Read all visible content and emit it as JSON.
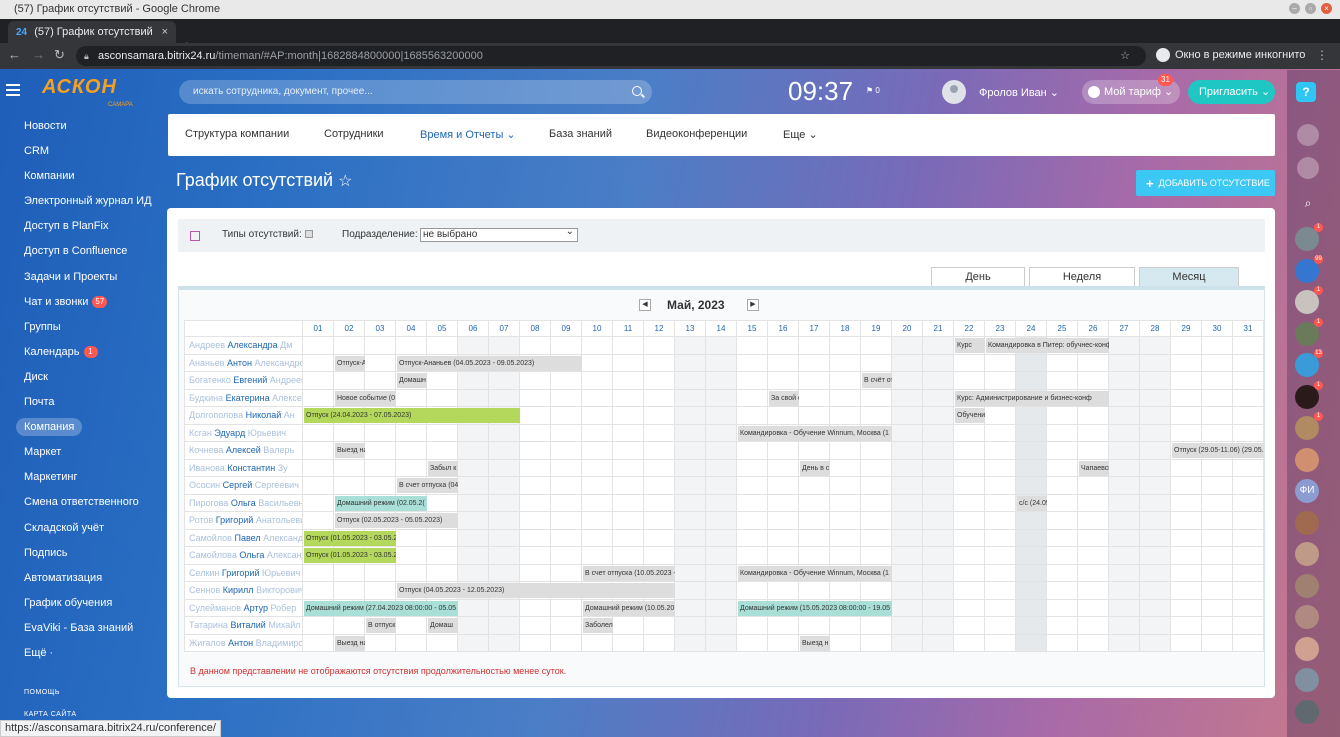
{
  "browser": {
    "window_title": "(57) График отсутствий - Google Chrome",
    "tab_title": "(57) График отсутствий",
    "tab_favicon": "24",
    "url_host": "asconsamara.bitrix24.ru",
    "url_path": "/timeman/#AP:month|1682884800000|1685563200000",
    "incognito_label": "Окно в режиме инкогнито",
    "status_url": "https://asconsamara.bitrix24.ru/conference/"
  },
  "header": {
    "logo_text": "АСКОН",
    "logo_sub": "САМАРА",
    "search_placeholder": "искать сотрудника, документ, прочее...",
    "clock": "09:37",
    "flag_count": "0",
    "user_name": "Фролов Иван",
    "tariff_label": "Мой тариф",
    "tariff_badge": "31",
    "invite_label": "Пригласить"
  },
  "sidebar": {
    "items": [
      {
        "label": "Новости",
        "badge": ""
      },
      {
        "label": "CRM",
        "badge": ""
      },
      {
        "label": "Компании",
        "badge": ""
      },
      {
        "label": "Электронный журнал ИД",
        "badge": ""
      },
      {
        "label": "Доступ в PlanFix",
        "badge": ""
      },
      {
        "label": "Доступ в Confluence",
        "badge": ""
      },
      {
        "label": "Задачи и Проекты",
        "badge": ""
      },
      {
        "label": "Чат и звонки",
        "badge": "57"
      },
      {
        "label": "Группы",
        "badge": ""
      },
      {
        "label": "Календарь",
        "badge": "1"
      },
      {
        "label": "Диск",
        "badge": ""
      },
      {
        "label": "Почта",
        "badge": ""
      },
      {
        "label": "Компания",
        "badge": "",
        "active": true
      },
      {
        "label": "Маркет",
        "badge": ""
      },
      {
        "label": "Маркетинг",
        "badge": ""
      },
      {
        "label": "Смена ответственного",
        "badge": ""
      },
      {
        "label": "Складской учёт",
        "badge": ""
      },
      {
        "label": "Подпись",
        "badge": ""
      },
      {
        "label": "Автоматизация",
        "badge": ""
      },
      {
        "label": "График обучения",
        "badge": ""
      },
      {
        "label": "EvaViki - База знаний",
        "badge": ""
      },
      {
        "label": "Ещё ·",
        "badge": ""
      }
    ],
    "help_label": "ПОМОЩЬ",
    "sitemap_label": "КАРТА САЙТА"
  },
  "topnav": {
    "items": [
      "Структура компании",
      "Сотрудники",
      "Время и Отчеты ⌄",
      "База знаний",
      "Видеоконференции",
      "Еще ⌄"
    ]
  },
  "page": {
    "title": "График отсутствий",
    "add_button": "ДОБАВИТЬ ОТСУТСТВИЕ"
  },
  "filter": {
    "types_label": "Типы отсутствий:",
    "division_label": "Подразделение:",
    "division_value": "не выбрано"
  },
  "views": {
    "day": "День",
    "week": "Неделя",
    "month": "Месяц"
  },
  "calendar": {
    "month_label": "Май, 2023",
    "days": [
      "01",
      "02",
      "03",
      "04",
      "05",
      "06",
      "07",
      "08",
      "09",
      "10",
      "11",
      "12",
      "13",
      "14",
      "15",
      "16",
      "17",
      "18",
      "19",
      "20",
      "21",
      "22",
      "23",
      "24",
      "25",
      "26",
      "27",
      "28",
      "29",
      "30",
      "31"
    ],
    "weekend_days": [
      6,
      7,
      13,
      14,
      20,
      21,
      27,
      28
    ],
    "today_day": 24,
    "employees": [
      {
        "blurred": "Андреев",
        "name": "Александра",
        "tail": "Дм"
      },
      {
        "blurred": "Ананьев",
        "name": "Антон",
        "tail": "Александрович"
      },
      {
        "blurred": "Богатенко",
        "name": "Евгений",
        "tail": "Андреевич"
      },
      {
        "blurred": "Будкина",
        "name": "Екатерина",
        "tail": "Алексеевна"
      },
      {
        "blurred": "Долгополова",
        "name": "Николай",
        "tail": "Ан"
      },
      {
        "blurred": "Ксган",
        "name": "Эдуард",
        "tail": "Юрьевич"
      },
      {
        "blurred": "Кочнева",
        "name": "Алексей",
        "tail": "Валерь"
      },
      {
        "blurred": "Иванова",
        "name": "Константин",
        "tail": "Зу"
      },
      {
        "blurred": "Ососин",
        "name": "Сергей",
        "tail": "Сергеевич"
      },
      {
        "blurred": "Пирогова",
        "name": "Ольга",
        "tail": "Васильевна"
      },
      {
        "blurred": "Ротов",
        "name": "Григорий",
        "tail": "Анатольевич"
      },
      {
        "blurred": "Самойлов",
        "name": "Павел",
        "tail": "Александрович"
      },
      {
        "blurred": "Самойлова",
        "name": "Ольга",
        "tail": "Александровна"
      },
      {
        "blurred": "Селкин",
        "name": "Григорий",
        "tail": "Юрьевич"
      },
      {
        "blurred": "Сеннов",
        "name": "Кирилл",
        "tail": "Викторович"
      },
      {
        "blurred": "Сулейманов",
        "name": "Артур",
        "tail": "Робер"
      },
      {
        "blurred": "Татарина",
        "name": "Виталий",
        "tail": "Михайл"
      },
      {
        "blurred": "Жигалов",
        "name": "Антон",
        "tail": "Владимирович"
      }
    ],
    "events": [
      {
        "row": 0,
        "start": 22,
        "end": 22,
        "color": "gray",
        "text": "Курс"
      },
      {
        "row": 0,
        "start": 23,
        "end": 26,
        "color": "gray",
        "text": "Командировка в Питер: обучнес-конф"
      },
      {
        "row": 1,
        "start": 2,
        "end": 2,
        "color": "gray",
        "text": "Отпуск-А"
      },
      {
        "row": 1,
        "start": 4,
        "end": 9,
        "color": "gray",
        "text": "Отпуск-Ананьев (04.05.2023 - 09.05.2023)"
      },
      {
        "row": 2,
        "start": 4,
        "end": 4,
        "color": "gray",
        "text": "Домашн"
      },
      {
        "row": 2,
        "start": 19,
        "end": 19,
        "color": "gray",
        "text": "В счёт от"
      },
      {
        "row": 3,
        "start": 2,
        "end": 3,
        "color": "gray",
        "text": "Новое событие (0"
      },
      {
        "row": 3,
        "start": 16,
        "end": 16,
        "color": "gray",
        "text": "За свой с"
      },
      {
        "row": 3,
        "start": 22,
        "end": 26,
        "color": "gray",
        "text": "Курс: Администрирование и бизнес-конф"
      },
      {
        "row": 4,
        "start": 1,
        "end": 7,
        "color": "green",
        "text": "Отпуск (24.04.2023 - 07.05.2023)"
      },
      {
        "row": 4,
        "start": 22,
        "end": 22,
        "color": "gray",
        "text": "Обучение"
      },
      {
        "row": 5,
        "start": 15,
        "end": 19,
        "color": "gray",
        "text": "Командировка - Обучение Winnum, Москва (1"
      },
      {
        "row": 6,
        "start": 2,
        "end": 2,
        "color": "gray",
        "text": "Выезд на"
      },
      {
        "row": 6,
        "start": 29,
        "end": 31,
        "color": "gray",
        "text": "Отпуск (29.05-11.06) (29.05."
      },
      {
        "row": 7,
        "start": 5,
        "end": 5,
        "color": "gray",
        "text": "Забыл к"
      },
      {
        "row": 7,
        "start": 17,
        "end": 17,
        "color": "gray",
        "text": "День в с"
      },
      {
        "row": 7,
        "start": 26,
        "end": 26,
        "color": "gray",
        "text": "Чапаевск"
      },
      {
        "row": 8,
        "start": 4,
        "end": 5,
        "color": "gray",
        "text": "В счет отпуска (04"
      },
      {
        "row": 9,
        "start": 2,
        "end": 4,
        "color": "teal",
        "text": "Домашний режим (02.05.2("
      },
      {
        "row": 9,
        "start": 24,
        "end": 24,
        "color": "gray",
        "text": "с/с (24.05"
      },
      {
        "row": 10,
        "start": 2,
        "end": 5,
        "color": "gray",
        "text": "Отпуск (02.05.2023 - 05.05.2023)"
      },
      {
        "row": 11,
        "start": 1,
        "end": 3,
        "color": "green",
        "text": "Отпуск (01.05.2023 - 03.05.2"
      },
      {
        "row": 12,
        "start": 1,
        "end": 3,
        "color": "green",
        "text": "Отпуск (01.05.2023 - 03.05.2"
      },
      {
        "row": 13,
        "start": 10,
        "end": 12,
        "color": "gray",
        "text": "В счет отпуска (10.05.2023 -"
      },
      {
        "row": 13,
        "start": 15,
        "end": 19,
        "color": "gray",
        "text": "Командировка - Обучение Winnum, Москва (1"
      },
      {
        "row": 14,
        "start": 4,
        "end": 12,
        "color": "gray",
        "text": "Отпуск (04.05.2023 - 12.05.2023)"
      },
      {
        "row": 15,
        "start": 1,
        "end": 5,
        "color": "teal",
        "text": "Домашний режим (27.04.2023 08:00:00 - 05.05"
      },
      {
        "row": 15,
        "start": 10,
        "end": 12,
        "color": "gray",
        "text": "Домашний режим (10.05.20"
      },
      {
        "row": 15,
        "start": 15,
        "end": 19,
        "color": "teal",
        "text": "Домашний режим (15.05.2023 08:00:00 - 19.05"
      },
      {
        "row": 16,
        "start": 3,
        "end": 3,
        "color": "gray",
        "text": "В отпуск"
      },
      {
        "row": 16,
        "start": 5,
        "end": 5,
        "color": "gray",
        "text": "Домаш"
      },
      {
        "row": 16,
        "start": 10,
        "end": 10,
        "color": "gray",
        "text": "Заболел"
      },
      {
        "row": 17,
        "start": 2,
        "end": 2,
        "color": "gray",
        "text": "Выезд на"
      },
      {
        "row": 17,
        "start": 17,
        "end": 17,
        "color": "gray",
        "text": "Выезд н"
      }
    ],
    "note": "В данном представлении не отображаются отсутствия продолжительностью менее суток."
  },
  "rightbar": {
    "help": "?",
    "avatars": [
      {
        "color": "#7a8a90",
        "badge": "1"
      },
      {
        "color": "#3577d0",
        "badge": "99"
      },
      {
        "color": "#c9c3c0",
        "badge": "1"
      },
      {
        "color": "#6a7a5a",
        "badge": "1"
      },
      {
        "color": "#3b9bd8",
        "badge": "13"
      },
      {
        "color": "#2a1a1a",
        "badge": "1"
      },
      {
        "color": "#b08a60",
        "badge": "1"
      },
      {
        "color": "#d09070",
        "badge": ""
      },
      {
        "color": "#8c9bd0",
        "badge": "",
        "text": "ФИ"
      },
      {
        "color": "#a06a50",
        "badge": ""
      },
      {
        "color": "#c09a88",
        "badge": ""
      },
      {
        "color": "#a08070",
        "badge": ""
      },
      {
        "color": "#b08a80",
        "badge": ""
      },
      {
        "color": "#d0a090",
        "badge": ""
      },
      {
        "color": "#8090a0",
        "badge": ""
      },
      {
        "color": "#606870",
        "badge": ""
      }
    ]
  },
  "colors": {
    "accent": "#2067b0",
    "green": "#b3d85c",
    "teal": "#a9dfd7",
    "gray_event": "#dddddd",
    "invite": "#1ec6c4",
    "add_button": "#3bc8f5"
  }
}
